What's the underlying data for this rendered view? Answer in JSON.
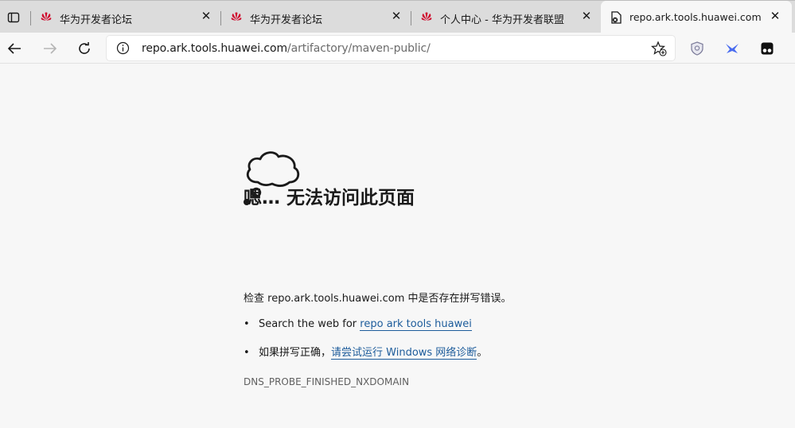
{
  "tabs": [
    {
      "title": "华为开发者论坛",
      "favicon": "huawei-logo-icon",
      "close": "✕"
    },
    {
      "title": "华为开发者论坛",
      "favicon": "huawei-logo-icon",
      "close": "✕"
    },
    {
      "title": "个人中心 - 华为开发者联盟",
      "favicon": "huawei-logo-icon",
      "close": "✕"
    },
    {
      "title": "repo.ark.tools.huawei.com",
      "favicon": "error-page-icon",
      "close": "✕",
      "active": true
    }
  ],
  "address": {
    "host": "repo.ark.tools.huawei.com",
    "path": "/artifactory/maven-public/"
  },
  "error": {
    "heading": "嗯… 无法访问此页面",
    "check_text": "检查 repo.ark.tools.huawei.com 中是否存在拼写错误。",
    "search_prefix": "Search the web for ",
    "search_link": "repo ark tools huawei",
    "diag_prefix": "如果拼写正确，",
    "diag_link": "请尝试运行 Windows 网络诊断",
    "diag_suffix": "。",
    "code": "DNS_PROBE_FINISHED_NXDOMAIN"
  },
  "colors": {
    "huawei_red": "#cf0a2c",
    "link": "#1d5c9b"
  }
}
